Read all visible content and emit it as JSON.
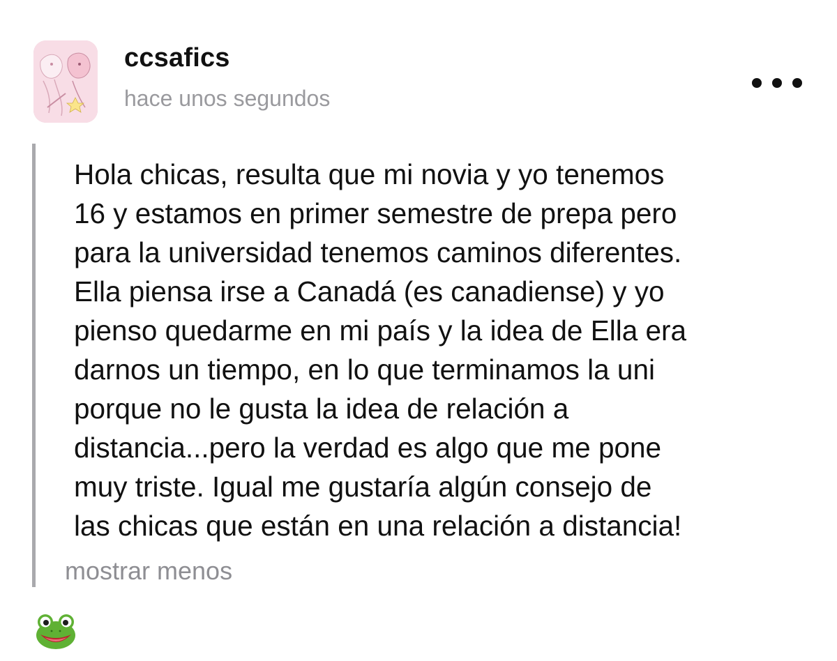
{
  "post": {
    "username": "ccsafics",
    "timestamp": "hace unos segundos",
    "more_icon": "more-dots-icon",
    "body_lines": [
      "Hola chicas, resulta que mi novia y yo tenemos",
      "16 y estamos en primer semestre de prepa pero",
      "para la universidad tenemos caminos diferentes.",
      "Ella piensa irse a Canadá (es canadiense) y yo",
      "pienso quedarme en mi país y la idea de Ella era",
      "darnos un tiempo, en lo que terminamos la uni",
      "porque no le gusta la idea de relación a",
      "distancia...pero la verdad es algo que me pone",
      "muy triste. Igual me gustaría algún consejo de",
      "las chicas que están en una relación a distancia!"
    ],
    "show_less_label": "mostrar menos",
    "reaction_icon": "frog-emoji-icon"
  },
  "colors": {
    "quote_bar": "#a9a9ad",
    "muted_text": "#9a9a9e",
    "show_less": "#8e8e93",
    "avatar_pink": "#f6d6e0",
    "frog_green": "#5fb134"
  }
}
